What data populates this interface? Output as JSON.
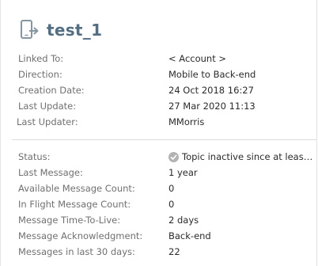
{
  "header": {
    "title": "test_1",
    "icon": "mobile-arrow-icon",
    "icon_color": "#8596a3"
  },
  "details": [
    {
      "label": "Linked To:",
      "value": "< Account >"
    },
    {
      "label": "Direction:",
      "value": "Mobile to Back-end"
    },
    {
      "label": "Creation Date:",
      "value": "24 Oct 2018 16:27"
    },
    {
      "label": "Last Update:",
      "value": "27 Mar 2020 11:13"
    },
    {
      "label": "Last Updater:",
      "value": "MMorris"
    }
  ],
  "status": {
    "label": "Status:",
    "value": "Topic inactive since at least one year",
    "icon": "check-circle-icon",
    "icon_color": "#b3b3b3"
  },
  "stats": [
    {
      "label": "Last Message:",
      "value": "1 year"
    },
    {
      "label": "Available Message Count:",
      "value": "0"
    },
    {
      "label": "In Flight Message Count:",
      "value": "0"
    },
    {
      "label": "Message Time-To-Live:",
      "value": "2 days"
    },
    {
      "label": "Message Acknowledgment:",
      "value": "Back-end"
    },
    {
      "label": "Messages in last 30 days:",
      "value": "22"
    }
  ],
  "colors": {
    "title": "#536e83",
    "label": "#707070",
    "value": "#2b2b2b"
  }
}
